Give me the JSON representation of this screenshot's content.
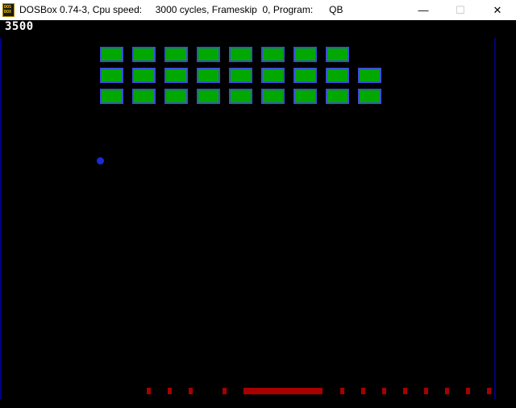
{
  "window": {
    "title": "DOSBox 0.74-3, Cpu speed:     3000 cycles, Frameskip  0, Program:      QB",
    "minimize_symbol": "—",
    "maximize_symbol": "☐",
    "close_symbol": "✕",
    "icon_text": "DOS BOX"
  },
  "game": {
    "score": "3500",
    "colors": {
      "brick_fill": "#00a800",
      "brick_border": "#3a50d0",
      "ball": "#1a2bd6",
      "paddle": "#a80000",
      "wall": "#000080",
      "background": "#000000"
    },
    "bricks_rows": [
      8,
      9,
      9
    ],
    "ball_icon": "ball-icon"
  }
}
